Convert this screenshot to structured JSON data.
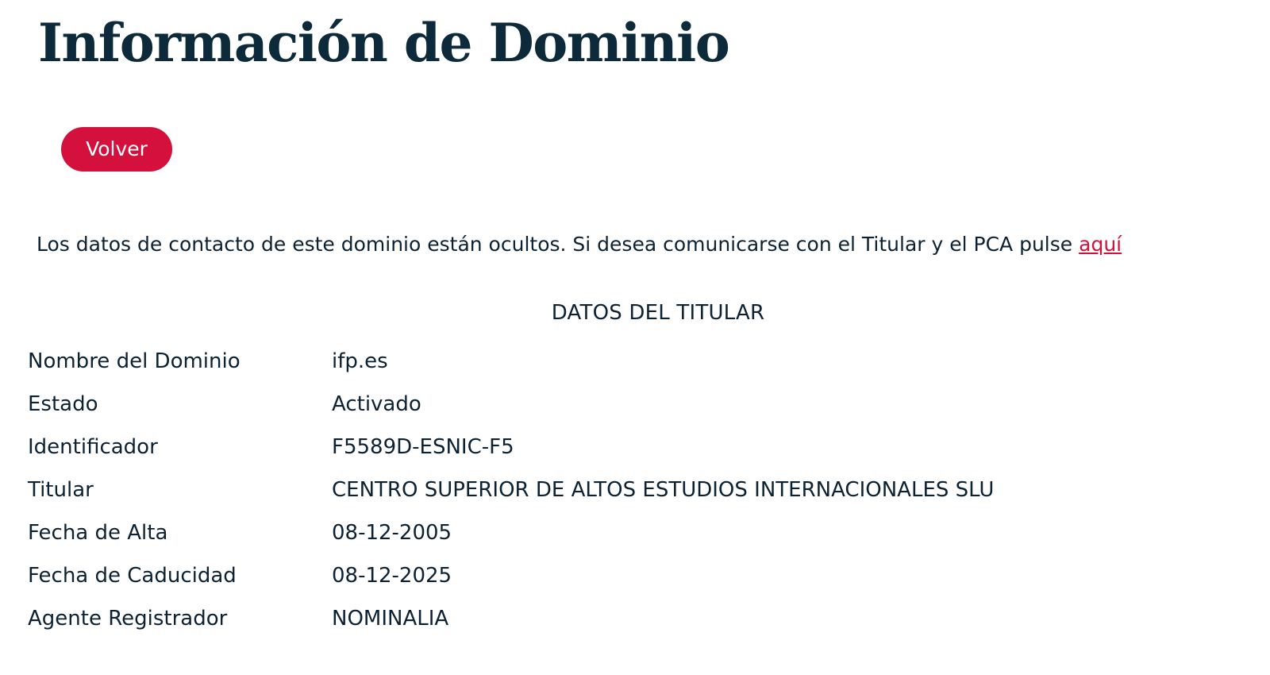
{
  "header": {
    "title": "Información de Dominio"
  },
  "actions": {
    "back_label": "Volver"
  },
  "notice": {
    "text": "Los datos de contacto de este dominio están ocultos. Si desea comunicarse con el Titular y el PCA pulse ",
    "link_label": "aquí"
  },
  "section": {
    "heading": "DATOS DEL TITULAR"
  },
  "rows": [
    {
      "label": "Nombre del Dominio",
      "value": "ifp.es"
    },
    {
      "label": "Estado",
      "value": "Activado"
    },
    {
      "label": "Identificador",
      "value": "F5589D-ESNIC-F5"
    },
    {
      "label": "Titular",
      "value": "CENTRO SUPERIOR DE ALTOS ESTUDIOS INTERNACIONALES SLU"
    },
    {
      "label": "Fecha de Alta",
      "value": "08-12-2005"
    },
    {
      "label": "Fecha de Caducidad",
      "value": "08-12-2025"
    },
    {
      "label": "Agente Registrador",
      "value": "NOMINALIA"
    }
  ],
  "colors": {
    "accent": "#d4113c",
    "title": "#0c2a3a",
    "text": "#0c2233"
  }
}
